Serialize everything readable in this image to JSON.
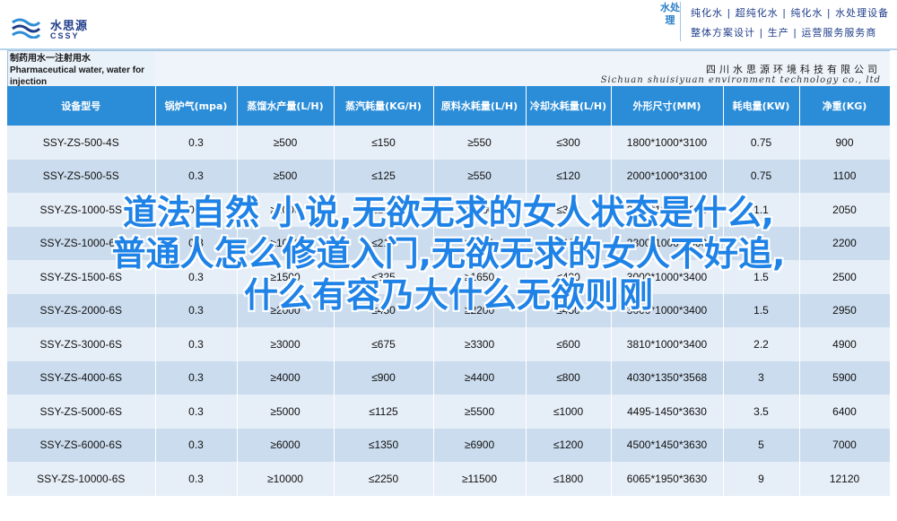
{
  "brand": {
    "name_cn": "水思源",
    "name_en": "CSSY",
    "vertical": "水处理",
    "tagline1": "纯化水 | 超纯化水 | 纯化水 | 水处理设备",
    "tagline2": "整体方案设计 | 生产 | 运营服务服务商"
  },
  "product": {
    "title": "制药用水一注射用水 Pharmaceutical water, water for injection"
  },
  "company": {
    "name_cn": "四川水思源环境科技有限公司",
    "name_en": "Sichuan shuisiyuan environment technology co., ltd"
  },
  "table": {
    "headers": [
      "设备型号",
      "锅炉气(mpa)",
      "蒸馏水产量(L/H)",
      "蒸汽耗量(KG/H)",
      "原料水耗量(L/H)",
      "冷却水耗量(L/H)",
      "外形尺寸(MM)",
      "耗电量(KW)",
      "净重(KG)"
    ],
    "rows": [
      [
        "SSY-ZS-500-4S",
        "0.3",
        "≥500",
        "≤150",
        "≥550",
        "≤300",
        "1800*1000*3100",
        "0.75",
        "900"
      ],
      [
        "SSY-ZS-500-5S",
        "0.3",
        "≥500",
        "≤125",
        "≥550",
        "≤120",
        "2000*1000*3100",
        "0.75",
        "1100"
      ],
      [
        "SSY-ZS-1000-5S",
        "0.3",
        "≥1000",
        "≤250",
        "≥1100",
        "≤300",
        "2200*1000*3300",
        "1.1",
        "2050"
      ],
      [
        "SSY-ZS-1000-6S",
        "0.3",
        "≥1000",
        "≤210",
        "≥1100",
        "≤300",
        "2300*1000*3300",
        "1.1",
        "2200"
      ],
      [
        "SSY-ZS-1500-6S",
        "0.3",
        "≥1500",
        "≤325",
        "≥1650",
        "≤400",
        "3000*1000*3400",
        "1.5",
        "2500"
      ],
      [
        "SSY-ZS-2000-6S",
        "0.3",
        "≥2000",
        "≤450",
        "≥2200",
        "≤450",
        "3000*1000*3400",
        "1.5",
        "2950"
      ],
      [
        "SSY-ZS-3000-6S",
        "0.3",
        "≥3000",
        "≤675",
        "≥3300",
        "≤600",
        "3810*1000*3400",
        "2.2",
        "4900"
      ],
      [
        "SSY-ZS-4000-6S",
        "0.3",
        "≥4000",
        "≤900",
        "≥4400",
        "≤800",
        "4030*1350*3568",
        "3",
        "5900"
      ],
      [
        "SSY-ZS-5000-6S",
        "0.3",
        "≥5000",
        "≤1125",
        "≥5500",
        "≤1000",
        "4495-1450*3630",
        "3.5",
        "6400"
      ],
      [
        "SSY-ZS-6000-6S",
        "0.3",
        "≥6000",
        "≤1350",
        "≥6900",
        "≤1200",
        "4500*1450*3630",
        "5",
        "7000"
      ],
      [
        "SSY-ZS-10000-6S",
        "0.3",
        "≥10000",
        "≤2250",
        "≥11500",
        "≤1800",
        "6065*1950*3630",
        "9",
        "12120"
      ]
    ]
  },
  "overlay": {
    "line1": "道法自然 小说,无欲无求的女人状态是什么,",
    "line2": "普通人怎么修道入门,无欲无求的女人不好追,",
    "line3": "什么有容乃大什么无欲则刚"
  },
  "colors": {
    "header_blue": "#2b8dd8",
    "row_light": "#e6eef7",
    "row_dark": "#cbdcee",
    "overlay_blue": "#1e82e6",
    "brand_navy": "#1f3d8a"
  }
}
